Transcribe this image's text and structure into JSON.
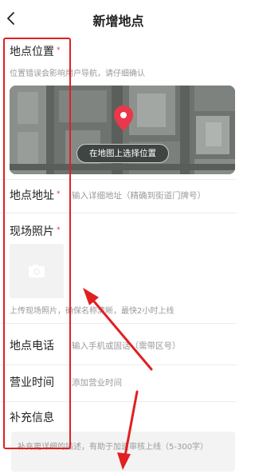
{
  "header": {
    "title": "新增地点"
  },
  "location": {
    "label": "地点位置",
    "required_mark": "*",
    "hint": "位置错误会影响用户导航，请仔细确认",
    "map_button": "在地图上选择位置"
  },
  "address": {
    "label": "地点地址",
    "required_mark": "*",
    "placeholder": "输入详细地址（精确到街道门牌号）"
  },
  "photo": {
    "label": "现场照片",
    "required_mark": "*",
    "hint": "上传现场照片，确保名称清晰，最快2小时上线"
  },
  "phone": {
    "label": "地点电话",
    "placeholder": "输入手机或固话（需带区号）"
  },
  "hours": {
    "label": "营业时间",
    "placeholder": "添加营业时间"
  },
  "extra": {
    "label": "补充信息",
    "placeholder": "补充更详细的描述，有助于加速审核上线（5-300字）"
  },
  "colors": {
    "required": "#e53935",
    "annotation": "#e02020"
  }
}
